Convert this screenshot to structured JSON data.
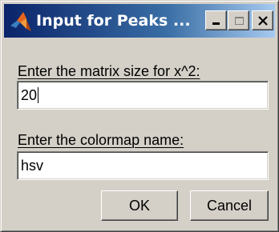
{
  "window": {
    "title": "Input for Peaks ...",
    "app_icon": "matlab-icon"
  },
  "title_buttons": {
    "minimize_icon": "minimize-icon",
    "maximize_icon": "maximize-icon",
    "close_icon": "close-icon"
  },
  "fields": [
    {
      "label": "Enter the matrix size for x^2:",
      "value": "20"
    },
    {
      "label": "Enter the colormap name:",
      "value": "hsv"
    }
  ],
  "buttons": {
    "ok_label": "OK",
    "cancel_label": "Cancel"
  },
  "colors": {
    "titlebar_start": "#0a246a",
    "titlebar_end": "#a6caf0",
    "dialog_face": "#d4d0c8"
  }
}
